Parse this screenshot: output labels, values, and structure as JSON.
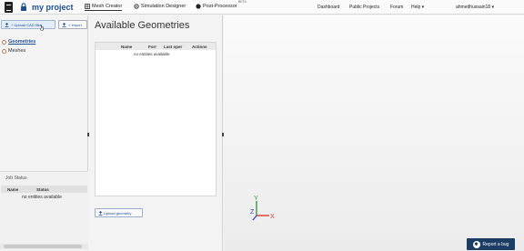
{
  "header": {
    "project_title": "my project",
    "nav": [
      {
        "label": "Mesh Creator",
        "active": true
      },
      {
        "label": "Simulation Designer",
        "active": false
      },
      {
        "label": "Post-Processor",
        "active": false
      }
    ],
    "beta_badge": "BETA",
    "links": [
      "Dashboard",
      "Public Projects",
      "Forum",
      "Help ▾"
    ],
    "user": "ahmedhussain18 ▾"
  },
  "left_panel": {
    "upload_button": "+ Upload CAD files",
    "import_button": "+ Import",
    "tree": [
      {
        "label": "Geometries",
        "selected": true
      },
      {
        "label": "Meshes",
        "selected": false
      }
    ],
    "job_status": {
      "title": "Job Status",
      "columns": [
        "Name",
        "Status"
      ],
      "empty_text": "no entities available"
    }
  },
  "center_panel": {
    "title": "Available Geometries",
    "columns": [
      "Name",
      "Forr",
      "Last oper",
      "Actions"
    ],
    "empty_text": "no entities available",
    "upload_geometry_button": "Upload geometry"
  },
  "viewport": {
    "axis_labels": {
      "y": "Y",
      "z": "Z",
      "x": "X"
    },
    "axis_colors": {
      "x": "#d93a2b",
      "y": "#3a9a3f",
      "z": "#3b47c9"
    },
    "report_bug_label": "Report a bug"
  },
  "colors": {
    "accent": "#1d4f91",
    "bug_button": "#1c3c63"
  }
}
